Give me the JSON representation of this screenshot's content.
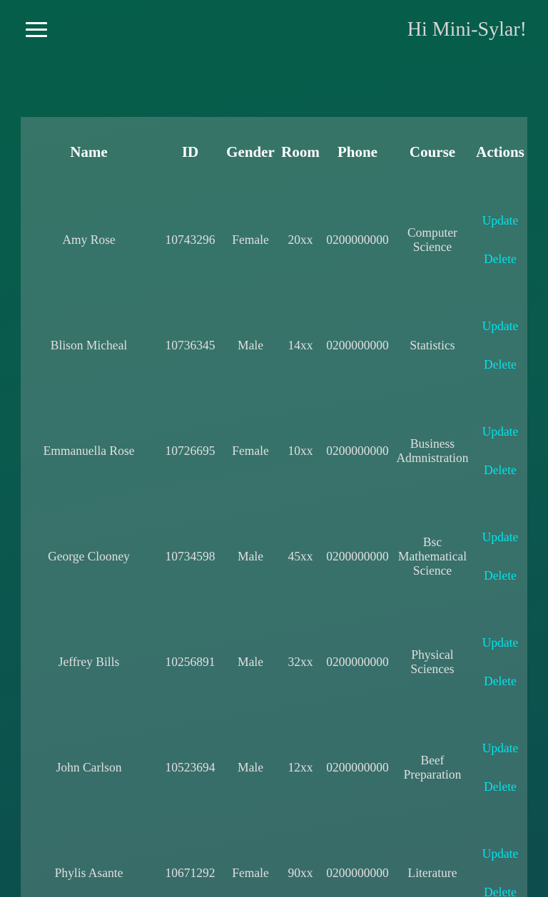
{
  "header": {
    "greeting": "Hi Mini-Sylar!"
  },
  "icons": {
    "menu": "hamburger-menu-icon"
  },
  "colors": {
    "action_link": "#00e5ee",
    "panel": "#4a7c76",
    "background": "#055e49"
  },
  "table": {
    "columns": [
      "Name",
      "ID",
      "Gender",
      "Room",
      "Phone",
      "Course",
      "Actions"
    ],
    "update_label": "Update",
    "delete_label": "Delete",
    "rows": [
      {
        "name": "Amy Rose",
        "id": "10743296",
        "gender": "Female",
        "room": "20xx",
        "phone": "0200000000",
        "course": "Computer Science"
      },
      {
        "name": "Blison Micheal",
        "id": "10736345",
        "gender": "Male",
        "room": "14xx",
        "phone": "0200000000",
        "course": "Statistics"
      },
      {
        "name": "Emmanuella Rose",
        "id": "10726695",
        "gender": "Female",
        "room": "10xx",
        "phone": "0200000000",
        "course": "Business Admnistration"
      },
      {
        "name": "George Clooney",
        "id": "10734598",
        "gender": "Male",
        "room": "45xx",
        "phone": "0200000000",
        "course": "Bsc Mathematical Science"
      },
      {
        "name": "Jeffrey Bills",
        "id": "10256891",
        "gender": "Male",
        "room": "32xx",
        "phone": "0200000000",
        "course": "Physical Sciences"
      },
      {
        "name": "John Carlson",
        "id": "10523694",
        "gender": "Male",
        "room": "12xx",
        "phone": "0200000000",
        "course": "Beef Preparation"
      },
      {
        "name": "Phylis Asante",
        "id": "10671292",
        "gender": "Female",
        "room": "90xx",
        "phone": "0200000000",
        "course": "Literature"
      }
    ]
  }
}
